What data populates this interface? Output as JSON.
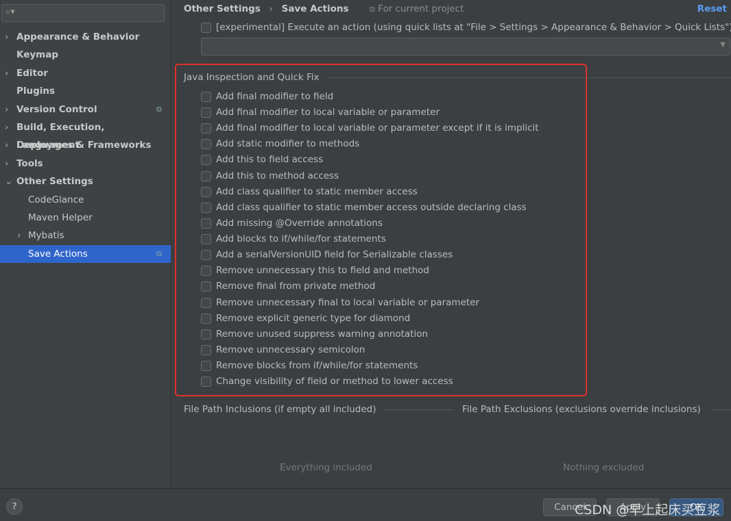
{
  "sidebar": {
    "search_placeholder": "",
    "items": [
      {
        "label": "Appearance & Behavior",
        "chevron": "›"
      },
      {
        "label": "Keymap",
        "chevron": ""
      },
      {
        "label": "Editor",
        "chevron": "›"
      },
      {
        "label": "Plugins",
        "chevron": ""
      },
      {
        "label": "Version Control",
        "chevron": "›",
        "copy": true
      },
      {
        "label": "Build, Execution, Deployment",
        "chevron": "›"
      },
      {
        "label": "Languages & Frameworks",
        "chevron": "›"
      },
      {
        "label": "Tools",
        "chevron": "›"
      },
      {
        "label": "Other Settings",
        "chevron": "⌄"
      },
      {
        "label": "CodeGlance",
        "chevron": "",
        "sub": true
      },
      {
        "label": "Maven Helper",
        "chevron": "",
        "sub": true
      },
      {
        "label": "Mybatis",
        "chevron": "›",
        "sub": true
      },
      {
        "label": "Save Actions",
        "chevron": "",
        "sub": true,
        "selected": true,
        "copy": true
      }
    ]
  },
  "header": {
    "crumb1": "Other Settings",
    "sep": "›",
    "crumb2": "Save Actions",
    "scope": "For current project",
    "reset": "Reset"
  },
  "experimental": {
    "label": "[experimental] Execute an action (using quick lists at \"File > Settings > Appearance & Behavior > Quick Lists\")",
    "combo_value": ""
  },
  "java_section": {
    "title": "Java Inspection and Quick Fix",
    "options": [
      "Add final modifier to field",
      "Add final modifier to local variable or parameter",
      "Add final modifier to local variable or parameter except if it is implicit",
      "Add static modifier to methods",
      "Add this to field access",
      "Add this to method access",
      "Add class qualifier to static member access",
      "Add class qualifier to static member access outside declaring class",
      "Add missing @Override annotations",
      "Add blocks to if/while/for statements",
      "Add a serialVersionUID field for Serializable classes",
      "Remove unnecessary this to field and method",
      "Remove final from private method",
      "Remove unnecessary final to local variable or parameter",
      "Remove explicit generic type for diamond",
      "Remove unused suppress warning annotation",
      "Remove unnecessary semicolon",
      "Remove blocks from if/while/for statements",
      "Change visibility of field or method to lower access"
    ]
  },
  "inclusions": {
    "title": "File Path Inclusions (if empty all included)",
    "empty": "Everything included"
  },
  "exclusions": {
    "title": "File Path Exclusions (exclusions override inclusions)",
    "empty": "Nothing excluded"
  },
  "footer": {
    "help": "?",
    "cancel": "Cancel",
    "apply": "Apply",
    "ok": "OK"
  },
  "watermark": "CSDN @早上起床买豆浆",
  "colors": {
    "accent": "#2f65ca",
    "highlight_box": "#e0322b",
    "link": "#589df6"
  }
}
